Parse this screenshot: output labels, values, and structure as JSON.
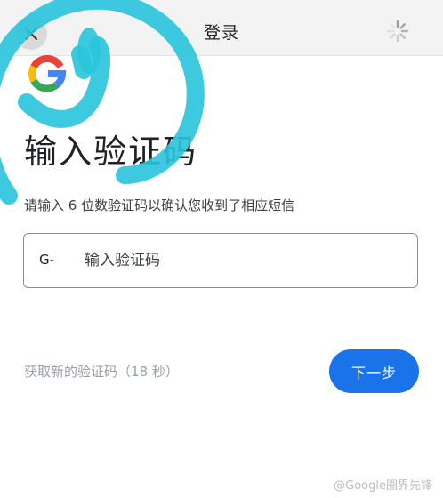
{
  "header": {
    "title": "登录",
    "close_icon": "close-icon",
    "loading_icon": "spinner-icon"
  },
  "logo": "google-g-logo",
  "main": {
    "heading": "输入验证码",
    "subtitle": "请输入 6 位数验证码以确认您收到了相应短信",
    "code_prefix": "G-",
    "code_placeholder": "输入验证码",
    "code_value": "",
    "resend_text": "获取新的验证码（18 秒）",
    "next_label": "下一步"
  },
  "colors": {
    "accent": "#1a73e8",
    "header_bg": "#f3f3f3",
    "overlay_sticker": "#29c4dc"
  },
  "watermark": "@Google圈界先锋"
}
